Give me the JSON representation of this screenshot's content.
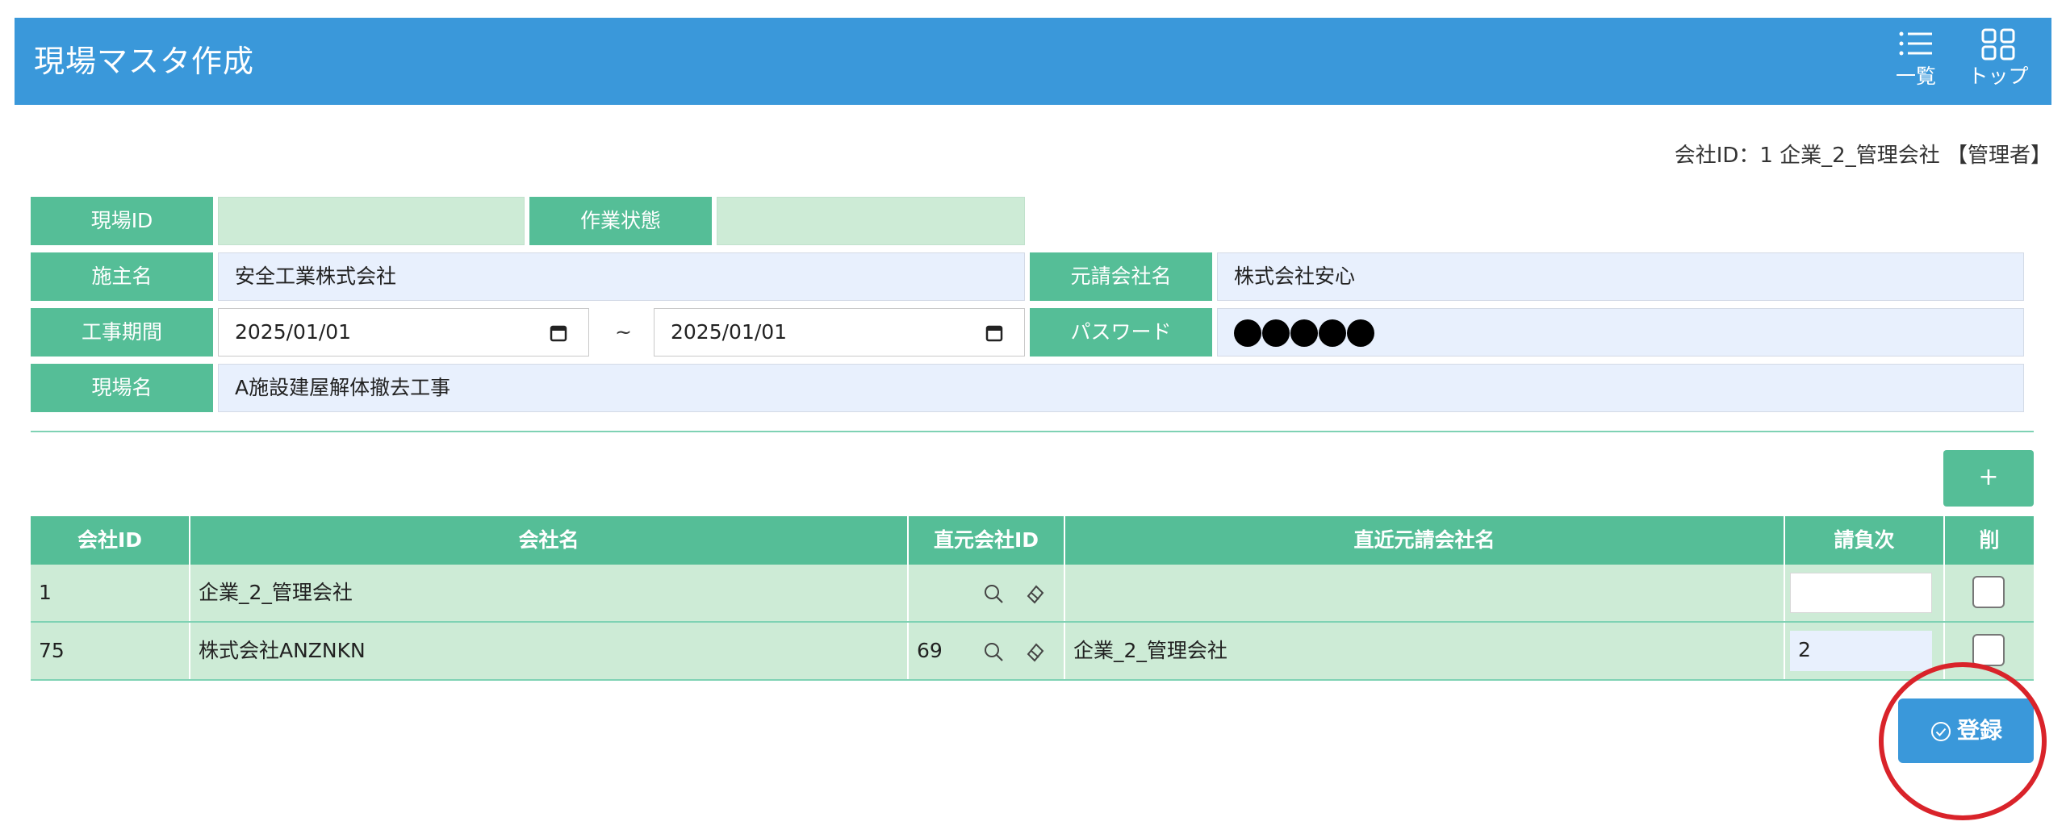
{
  "header": {
    "title": "現場マスタ作成",
    "list_label": "一覧",
    "top_label": "トップ",
    "list_icon": "list-icon",
    "top_icon": "grid-icon"
  },
  "account": {
    "text": "会社ID：1 企業_2_管理会社 【管理者】"
  },
  "form": {
    "site_id_label": "現場ID",
    "site_id_value": "",
    "work_status_label": "作業状態",
    "work_status_value": "",
    "client_label": "施主名",
    "client_value": "安全工業株式会社",
    "prime_contractor_label": "元請会社名",
    "prime_contractor_value": "株式会社安心",
    "period_label": "工事期間",
    "period_start": "2025/01/01",
    "period_sep": "~",
    "period_end": "2025/01/01",
    "password_label": "パスワード",
    "password_dots": 5,
    "site_name_label": "現場名",
    "site_name_value": "A施設建屋解体撤去工事"
  },
  "add_button": {
    "label": "+"
  },
  "table": {
    "headers": [
      "会社ID",
      "会社名",
      "直元会社ID",
      "直近元請会社名",
      "請負次",
      "削"
    ],
    "rows": [
      {
        "company_id": "1",
        "company_name": "企業_2_管理会社",
        "parent_id": "",
        "parent_name": "",
        "tier": "",
        "delete_checked": false
      },
      {
        "company_id": "75",
        "company_name": "株式会社ANZNKN",
        "parent_id": "69",
        "parent_name": "企業_2_管理会社",
        "tier": "2",
        "delete_checked": false
      }
    ]
  },
  "register_button": {
    "label": "登録",
    "icon": "check-circle-icon"
  },
  "colors": {
    "header_blue": "#3a98da",
    "label_green": "#55be97",
    "row_green": "#cdebd6",
    "field_blue": "#e8f0fd",
    "callout_red": "#d9232a"
  }
}
